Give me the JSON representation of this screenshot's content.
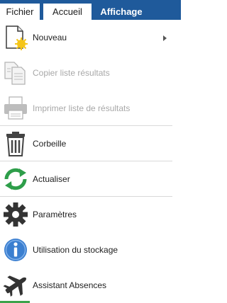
{
  "ribbon": {
    "tabs": [
      {
        "label": "Fichier"
      },
      {
        "label": "Accueil"
      },
      {
        "label": "Affichage"
      }
    ]
  },
  "menu": {
    "items": [
      {
        "label": "Nouveau",
        "icon": "new-document-icon",
        "enabled": true,
        "has_submenu": true
      },
      {
        "label": "Copier liste résultats",
        "icon": "copy-icon",
        "enabled": false
      },
      {
        "label": "Imprimer liste de résultats",
        "icon": "printer-icon",
        "enabled": false
      },
      {
        "label": "Corbeille",
        "icon": "trash-icon",
        "enabled": true
      },
      {
        "label": "Actualiser",
        "icon": "refresh-icon",
        "enabled": true
      },
      {
        "label": "Paramètres",
        "icon": "gear-icon",
        "enabled": true
      },
      {
        "label": "Utilisation du stockage",
        "icon": "info-icon",
        "enabled": true
      },
      {
        "label": "Assistant Absences",
        "icon": "airplane-icon",
        "enabled": true
      }
    ]
  },
  "colors": {
    "ribbon": "#1f5a9b",
    "disabled_text": "#a8a8a8",
    "refresh_green": "#2e9e4a",
    "info_blue": "#3b7fd0"
  }
}
